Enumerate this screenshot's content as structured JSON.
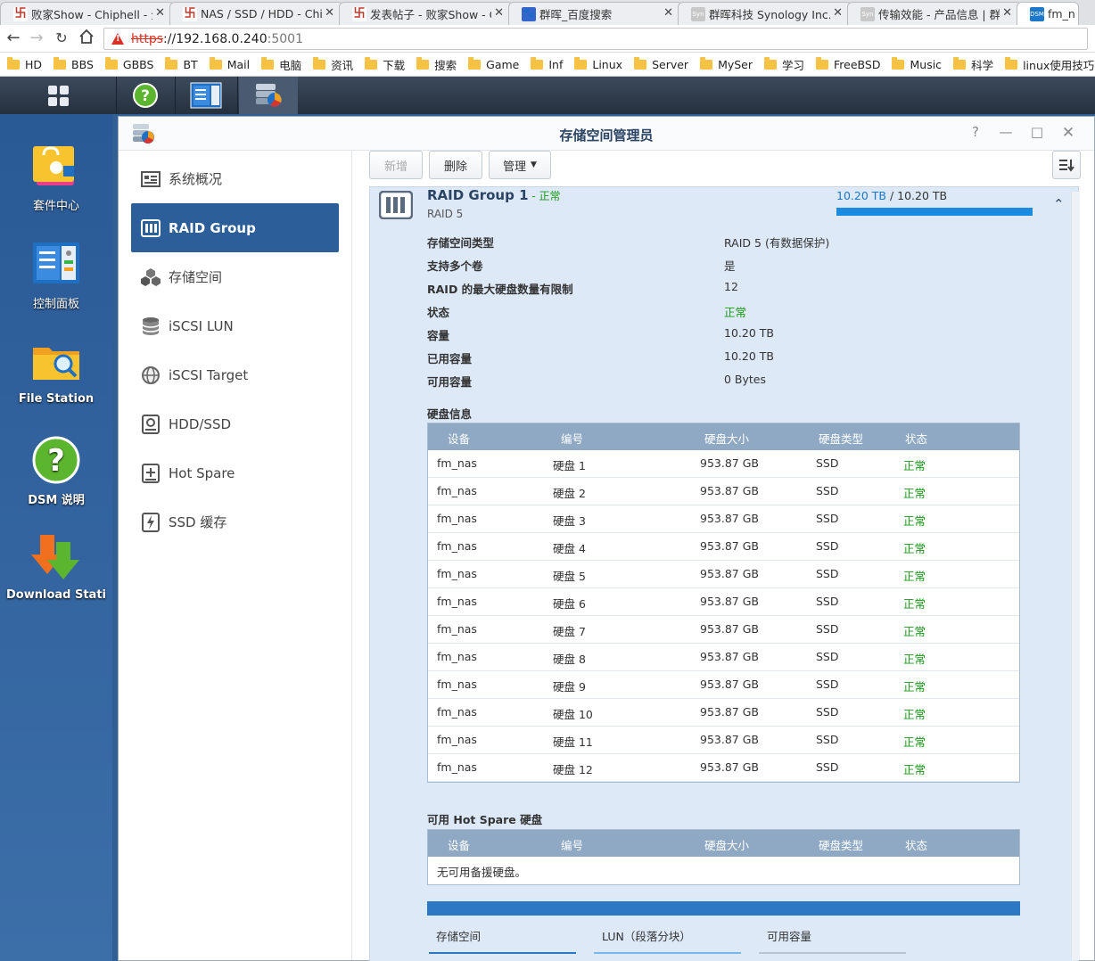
{
  "browser": {
    "tabs": [
      {
        "title": "败家Show - Chiphell - 分",
        "icon": "chiphell-icon"
      },
      {
        "title": "NAS / SSD / HDD - Chi",
        "icon": "chiphell-icon"
      },
      {
        "title": "发表帖子 - 败家Show - C",
        "icon": "chiphell-icon"
      },
      {
        "title": "群晖_百度搜索",
        "icon": "baidu-icon"
      },
      {
        "title": "群晖科技 Synology Inc.",
        "icon": "synology-icon"
      },
      {
        "title": "传输效能 - 产品信息 | 群",
        "icon": "synology-icon"
      },
      {
        "title": "fm_na",
        "icon": "dsm-icon"
      }
    ],
    "url_scheme": "https",
    "url_sep": "://",
    "url_host": "192.168.0.240",
    "url_port": ":5001",
    "bookmarks": [
      "HD",
      "BBS",
      "GBBS",
      "BT",
      "Mail",
      "电脑",
      "资讯",
      "下载",
      "搜索",
      "Game",
      "Inf",
      "Linux",
      "Server",
      "MySer",
      "学习",
      "FreeBSD",
      "Music",
      "科学",
      "linux使用技巧"
    ]
  },
  "desktop": {
    "icons": [
      {
        "label": "套件中心"
      },
      {
        "label": "控制面板"
      },
      {
        "label": "File Station"
      },
      {
        "label": "DSM 说明"
      },
      {
        "label": "Download Stati"
      }
    ]
  },
  "window": {
    "title": "存储空间管理员",
    "sidebar": [
      {
        "label": "系统概况"
      },
      {
        "label": "RAID Group"
      },
      {
        "label": "存储空间"
      },
      {
        "label": "iSCSI LUN"
      },
      {
        "label": "iSCSI Target"
      },
      {
        "label": "HDD/SSD"
      },
      {
        "label": "Hot Spare"
      },
      {
        "label": "SSD 缓存"
      }
    ],
    "toolbar": {
      "add": "新增",
      "delete": "删除",
      "manage": "管理"
    },
    "raid": {
      "title": "RAID Group 1",
      "status_sep": " - ",
      "status": "正常",
      "level": "RAID 5",
      "used": "10.20 TB",
      "cap_sep": " / ",
      "total": "10.20 TB",
      "usage_fraction": 1.0,
      "props": [
        {
          "label": "存储空间类型",
          "value": "RAID 5 (有数据保护)"
        },
        {
          "label": "支持多个卷",
          "value": "是"
        },
        {
          "label": "RAID 的最大硬盘数量有限制",
          "value": "12"
        },
        {
          "label": "状态",
          "value": "正常",
          "ok": true
        },
        {
          "label": "容量",
          "value": "10.20 TB"
        },
        {
          "label": "已用容量",
          "value": "10.20 TB"
        },
        {
          "label": "可用容量",
          "value": "0 Bytes"
        }
      ],
      "disk_section": "硬盘信息",
      "columns": [
        "设备",
        "编号",
        "硬盘大小",
        "硬盘类型",
        "状态"
      ],
      "disks": [
        [
          "fm_nas",
          "硬盘 1",
          "953.87 GB",
          "SSD",
          "正常"
        ],
        [
          "fm_nas",
          "硬盘 2",
          "953.87 GB",
          "SSD",
          "正常"
        ],
        [
          "fm_nas",
          "硬盘 3",
          "953.87 GB",
          "SSD",
          "正常"
        ],
        [
          "fm_nas",
          "硬盘 4",
          "953.87 GB",
          "SSD",
          "正常"
        ],
        [
          "fm_nas",
          "硬盘 5",
          "953.87 GB",
          "SSD",
          "正常"
        ],
        [
          "fm_nas",
          "硬盘 6",
          "953.87 GB",
          "SSD",
          "正常"
        ],
        [
          "fm_nas",
          "硬盘 7",
          "953.87 GB",
          "SSD",
          "正常"
        ],
        [
          "fm_nas",
          "硬盘 8",
          "953.87 GB",
          "SSD",
          "正常"
        ],
        [
          "fm_nas",
          "硬盘 9",
          "953.87 GB",
          "SSD",
          "正常"
        ],
        [
          "fm_nas",
          "硬盘 10",
          "953.87 GB",
          "SSD",
          "正常"
        ],
        [
          "fm_nas",
          "硬盘 11",
          "953.87 GB",
          "SSD",
          "正常"
        ],
        [
          "fm_nas",
          "硬盘 12",
          "953.87 GB",
          "SSD",
          "正常"
        ]
      ],
      "hotspare_section": "可用 Hot Spare 硬盘",
      "hotspare_empty": "无可用备援硬盘。",
      "volume_tabs": [
        "存储空间",
        "LUN（段落分块）",
        "可用容量"
      ]
    }
  }
}
